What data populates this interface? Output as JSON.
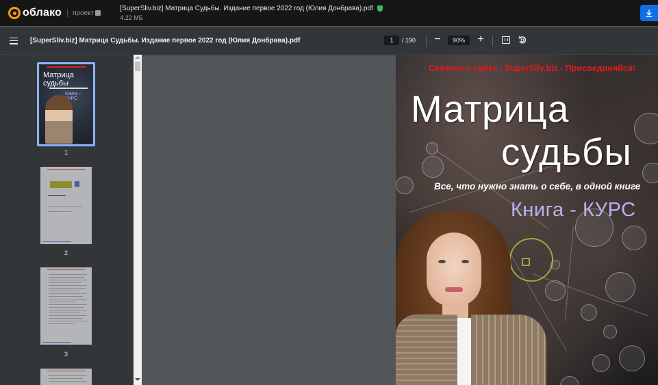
{
  "app": {
    "logo_text": "облако",
    "project_label": "проект",
    "file_title": "[SuperSliv.biz] Матрица Судьбы. Издание первое 2022 год (Юлия Донбрава).pdf",
    "file_size": "4.22 МБ",
    "brand_color": "#ff9e00",
    "download_button_color": "#0f6fe6",
    "download_icon": "download-icon",
    "verified_icon": "shield-check-icon"
  },
  "toolbar": {
    "doc_title": "[SuperSliv.biz] Матрица Судьбы. Издание первое 2022 год (Юлия Донбрава).pdf",
    "current_page": "1",
    "page_separator": "/ 190",
    "total_pages": 190,
    "zoom_out_label": "−",
    "zoom_value": "90%",
    "zoom_in_label": "+",
    "menu_icon": "hamburger-menu-icon",
    "fit_icon": "fit-page-icon",
    "rotate_icon": "rotate-icon"
  },
  "sidebar": {
    "thumbnails": [
      {
        "label": "1",
        "selected": true
      },
      {
        "label": "2",
        "selected": false
      },
      {
        "label": "3",
        "selected": false
      }
    ],
    "selection_color": "#8ab4f8"
  },
  "page": {
    "top_text": "Скачано с сайта - SuperSliv.biz - Присоединяйся!",
    "title_line1": "Матрица",
    "title_line2": "судьбы",
    "subtitle": "Все, что нужно знать о себе, в одной книге",
    "course": "Книга - КУРС",
    "top_text_color": "#e11b1b",
    "course_color": "#b7b2f2"
  },
  "mini_cover": {
    "title": "Матрица судьбы",
    "course": "Книга - КУРС"
  }
}
